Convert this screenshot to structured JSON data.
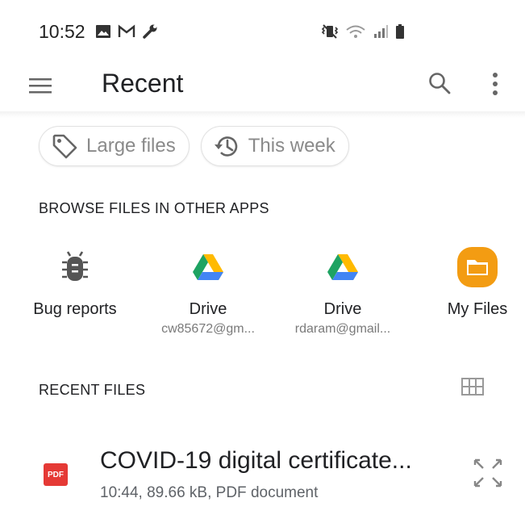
{
  "status_bar": {
    "time": "10:52",
    "left_icons": [
      "image-icon",
      "gmail-icon",
      "wrench-icon"
    ],
    "right_icons": [
      "vibrate-icon",
      "wifi-icon",
      "signal-icon",
      "battery-icon"
    ]
  },
  "app_bar": {
    "title": "Recent",
    "icons": [
      "menu-icon",
      "search-icon",
      "more-vert-icon"
    ]
  },
  "chips": [
    {
      "label": "Large files",
      "icon": "tag-icon"
    },
    {
      "label": "This week",
      "icon": "history-icon"
    }
  ],
  "browse_section": {
    "title": "BROWSE FILES IN OTHER APPS",
    "apps": [
      {
        "label": "Bug reports",
        "sub": "",
        "icon": "bug-icon"
      },
      {
        "label": "Drive",
        "sub": "cw85672@gm...",
        "icon": "drive-icon"
      },
      {
        "label": "Drive",
        "sub": "rdaram@gmail...",
        "icon": "drive-icon"
      },
      {
        "label": "My Files",
        "sub": "",
        "icon": "my-files-icon"
      }
    ]
  },
  "recent_section": {
    "title": "RECENT FILES",
    "view_toggle_icon": "grid-view-icon",
    "files": [
      {
        "name": "COVID-19 digital certificate...",
        "meta": "10:44, 89.66 kB, PDF document",
        "icon_text": "PDF",
        "icon": "pdf-icon"
      }
    ]
  },
  "colors": {
    "pdf_red": "#e53935",
    "my_files_orange": "#f39c12",
    "drive_green": "#1ea362",
    "drive_yellow": "#ffba00",
    "drive_blue": "#4285f4"
  }
}
